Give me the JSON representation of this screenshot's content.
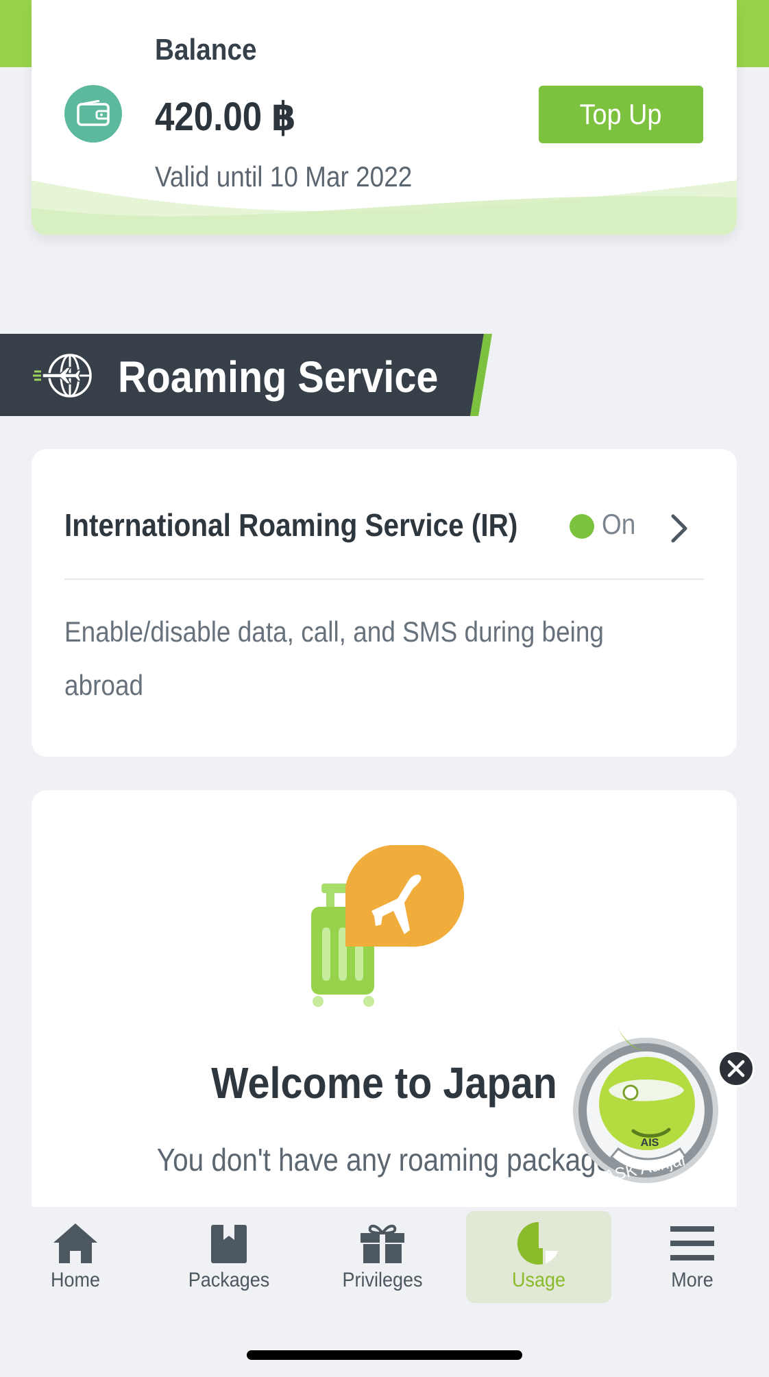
{
  "balance": {
    "label": "Balance",
    "amount": "420.00 ฿",
    "valid_until": "Valid until 10 Mar 2022",
    "topup_label": "Top Up"
  },
  "roaming": {
    "section_title": "Roaming Service",
    "ir_title": "International Roaming Service (IR)",
    "ir_status": "On",
    "ir_description": "Enable/disable data, call, and SMS during being abroad"
  },
  "welcome": {
    "title": "Welcome to Japan",
    "subtitle": "You don't have any roaming package"
  },
  "mascot": {
    "badge_text": "ASK Aunjai",
    "brand": "AIS"
  },
  "tabbar": {
    "items": [
      {
        "label": "Home",
        "icon": "home-icon",
        "active": false
      },
      {
        "label": "Packages",
        "icon": "packages-icon",
        "active": false
      },
      {
        "label": "Privileges",
        "icon": "gift-icon",
        "active": false
      },
      {
        "label": "Usage",
        "icon": "usage-pie-icon",
        "active": true
      },
      {
        "label": "More",
        "icon": "menu-icon",
        "active": false
      }
    ]
  },
  "colors": {
    "brand_green": "#7cc23f",
    "header_dark": "#374049",
    "wallet_teal": "#5cb99d",
    "plane_orange": "#f0ad3c"
  }
}
